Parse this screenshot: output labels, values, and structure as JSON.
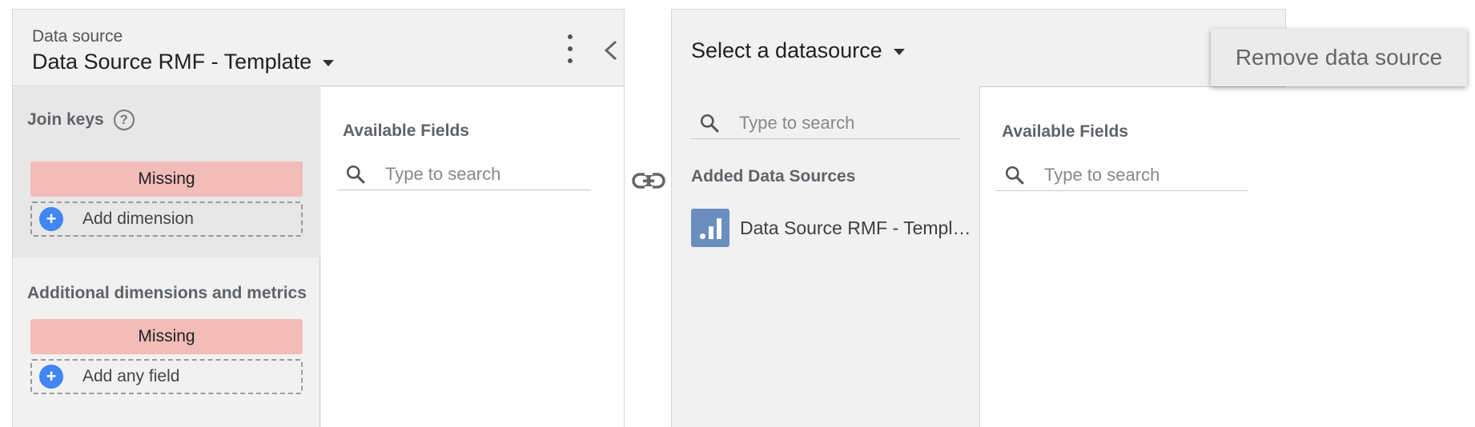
{
  "left_panel": {
    "caption": "Data source",
    "title": "Data Source RMF - Template",
    "join_keys": {
      "title": "Join keys",
      "help": "?",
      "missing": "Missing",
      "add_label": "Add dimension"
    },
    "additional": {
      "title": "Additional dimensions and metrics",
      "missing": "Missing",
      "add_label": "Add any field"
    },
    "available_fields": {
      "title": "Available Fields",
      "search_placeholder": "Type to search"
    }
  },
  "right_panel": {
    "title": "Select a datasource",
    "search_placeholder": "Type to search",
    "added_title": "Added Data Sources",
    "sources": [
      {
        "name": "Data Source RMF - Template",
        "icon": "analytics-icon"
      }
    ],
    "available_fields": {
      "title": "Available Fields",
      "search_placeholder": "Type to search"
    }
  },
  "context_menu": {
    "remove_label": "Remove data source"
  },
  "colors": {
    "panel_bg": "#f1f1f1",
    "join_zone_bg": "#e7e7e7",
    "missing_bg": "#f2bcb8",
    "plus_blue": "#4285f4",
    "ds_logo": "#6a8fbf"
  }
}
